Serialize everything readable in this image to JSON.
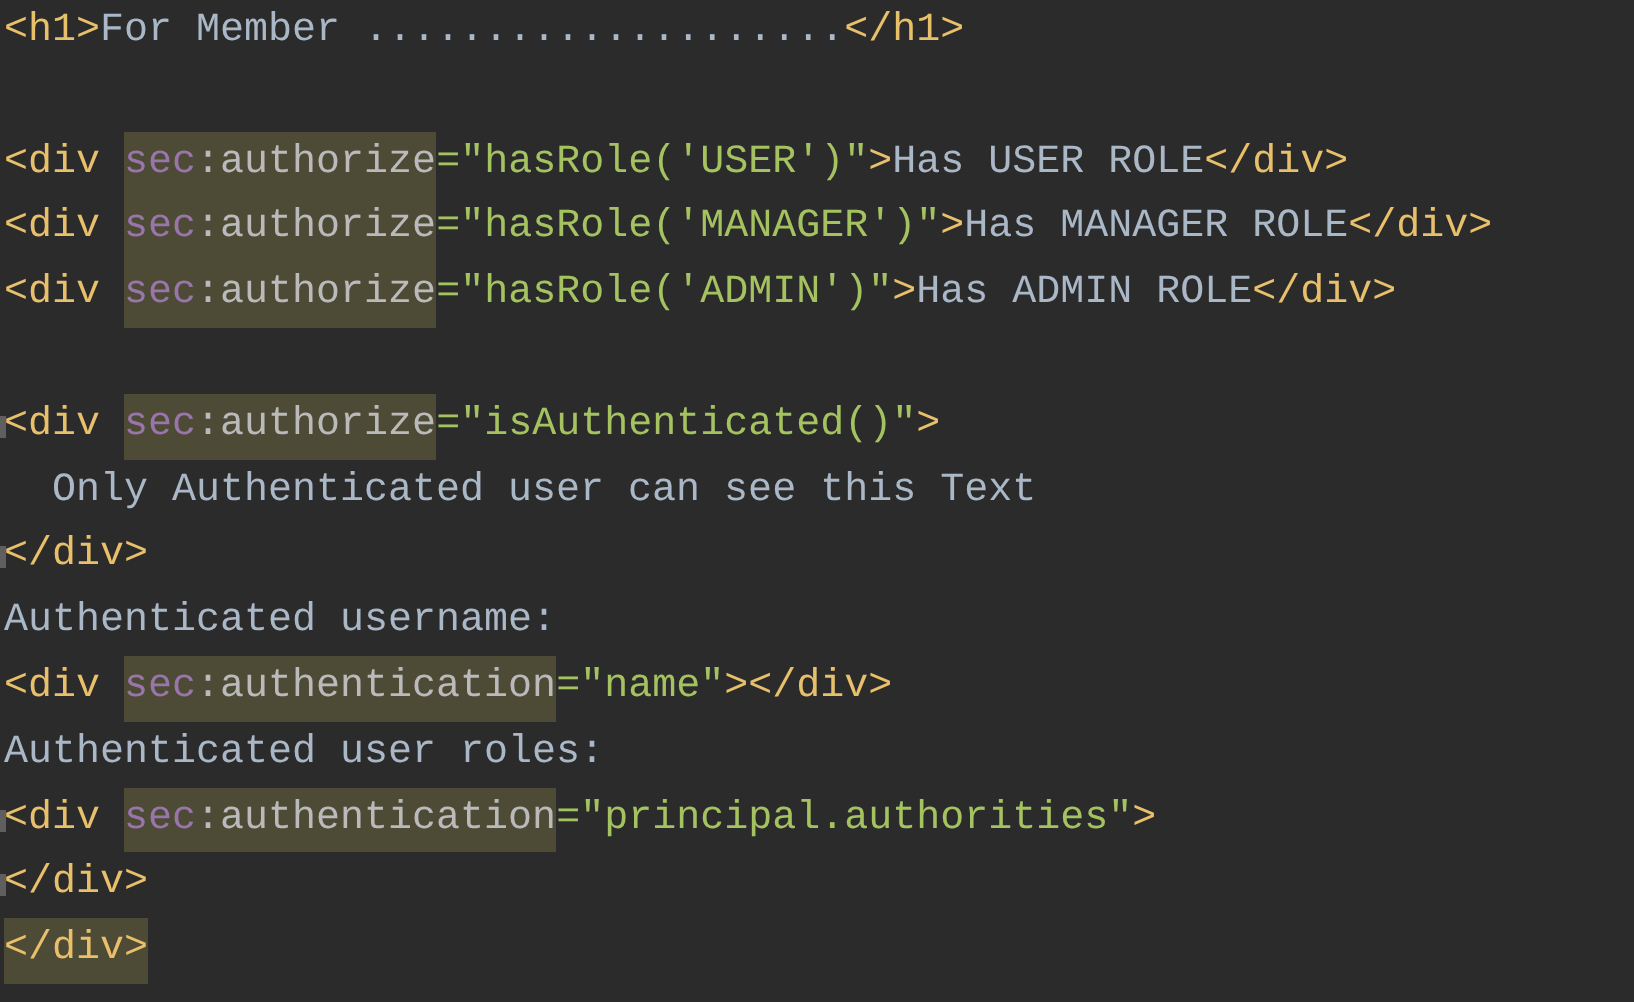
{
  "editor": {
    "lines": [
      {
        "kind": "code",
        "tokens": [
          {
            "text": "<h1>",
            "kind": "tag"
          },
          {
            "text": "For Member ....................",
            "kind": "text"
          },
          {
            "text": "</h1>",
            "kind": "tag"
          }
        ]
      },
      {
        "kind": "blank"
      },
      {
        "kind": "code",
        "tokens": [
          {
            "text": "<div ",
            "kind": "tag"
          },
          {
            "text": "sec",
            "kind": "ns",
            "highlighted": true
          },
          {
            "text": ":authorize",
            "kind": "attr",
            "highlighted": true
          },
          {
            "text": "=\"hasRole('USER')\"",
            "kind": "string"
          },
          {
            "text": ">",
            "kind": "tag"
          },
          {
            "text": "Has USER ROLE",
            "kind": "text"
          },
          {
            "text": "</div>",
            "kind": "tag"
          }
        ]
      },
      {
        "kind": "code",
        "tokens": [
          {
            "text": "<div ",
            "kind": "tag"
          },
          {
            "text": "sec",
            "kind": "ns",
            "highlighted": true
          },
          {
            "text": ":authorize",
            "kind": "attr",
            "highlighted": true
          },
          {
            "text": "=\"hasRole('MANAGER')\"",
            "kind": "string"
          },
          {
            "text": ">",
            "kind": "tag"
          },
          {
            "text": "Has MANAGER ROLE",
            "kind": "text"
          },
          {
            "text": "</div>",
            "kind": "tag"
          }
        ]
      },
      {
        "kind": "code",
        "tokens": [
          {
            "text": "<div ",
            "kind": "tag"
          },
          {
            "text": "sec",
            "kind": "ns",
            "highlighted": true
          },
          {
            "text": ":authorize",
            "kind": "attr",
            "highlighted": true
          },
          {
            "text": "=\"hasRole('ADMIN')\"",
            "kind": "string"
          },
          {
            "text": ">",
            "kind": "tag"
          },
          {
            "text": "Has ADMIN ROLE",
            "kind": "text"
          },
          {
            "text": "</div>",
            "kind": "tag"
          }
        ]
      },
      {
        "kind": "blank"
      },
      {
        "kind": "code",
        "fold_mark": true,
        "tokens": [
          {
            "text": "<div ",
            "kind": "tag"
          },
          {
            "text": "sec",
            "kind": "ns",
            "highlighted": true
          },
          {
            "text": ":authorize",
            "kind": "attr",
            "highlighted": true
          },
          {
            "text": "=\"isAuthenticated()\"",
            "kind": "string"
          },
          {
            "text": ">",
            "kind": "tag"
          }
        ]
      },
      {
        "kind": "code",
        "tokens": [
          {
            "text": "  Only Authenticated user can see this Text",
            "kind": "text"
          }
        ]
      },
      {
        "kind": "code",
        "fold_mark": true,
        "tokens": [
          {
            "text": "</div>",
            "kind": "tag"
          }
        ]
      },
      {
        "kind": "code",
        "tokens": [
          {
            "text": "Authenticated username:",
            "kind": "text"
          }
        ]
      },
      {
        "kind": "code",
        "tokens": [
          {
            "text": "<div ",
            "kind": "tag"
          },
          {
            "text": "sec",
            "kind": "ns",
            "highlighted": true
          },
          {
            "text": ":authentication",
            "kind": "attr",
            "highlighted": true
          },
          {
            "text": "=\"name\"",
            "kind": "string"
          },
          {
            "text": "></div>",
            "kind": "tag"
          }
        ]
      },
      {
        "kind": "code",
        "tokens": [
          {
            "text": "Authenticated user roles:",
            "kind": "text"
          }
        ]
      },
      {
        "kind": "code",
        "fold_mark": true,
        "tokens": [
          {
            "text": "<div ",
            "kind": "tag"
          },
          {
            "text": "sec",
            "kind": "ns",
            "highlighted": true
          },
          {
            "text": ":authentication",
            "kind": "attr",
            "highlighted": true
          },
          {
            "text": "=\"principal.authorities\"",
            "kind": "string"
          },
          {
            "text": ">",
            "kind": "tag"
          }
        ]
      },
      {
        "kind": "code",
        "fold_mark": true,
        "tokens": [
          {
            "text": "</div>",
            "kind": "tag"
          }
        ]
      },
      {
        "kind": "code",
        "tokens": [
          {
            "text": "</div>",
            "kind": "tag",
            "highlighted": true
          }
        ]
      }
    ]
  }
}
